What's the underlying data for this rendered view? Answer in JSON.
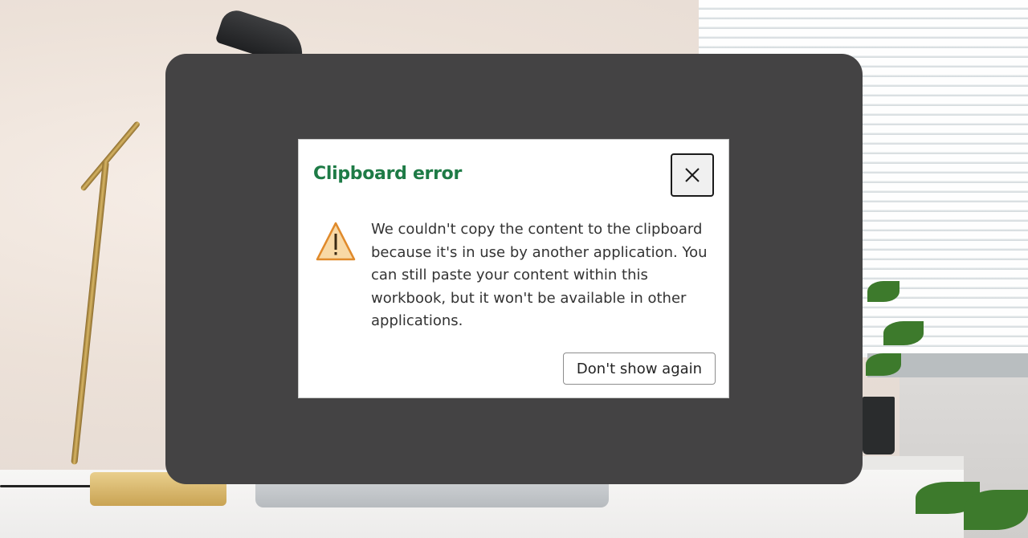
{
  "dialog": {
    "title": "Clipboard error",
    "message": "We couldn't copy the content to the clipboard because it's in use by another application. You can still paste your content within this workbook, but it won't be available in other applications.",
    "close_icon": "close-icon",
    "warning_icon": "warning-triangle-icon",
    "dont_show_label": "Don't show again"
  },
  "colors": {
    "title": "#1e7b46",
    "overlay": "#444344",
    "warning_fill": "#f8d9a6",
    "warning_stroke": "#e08a2b"
  }
}
